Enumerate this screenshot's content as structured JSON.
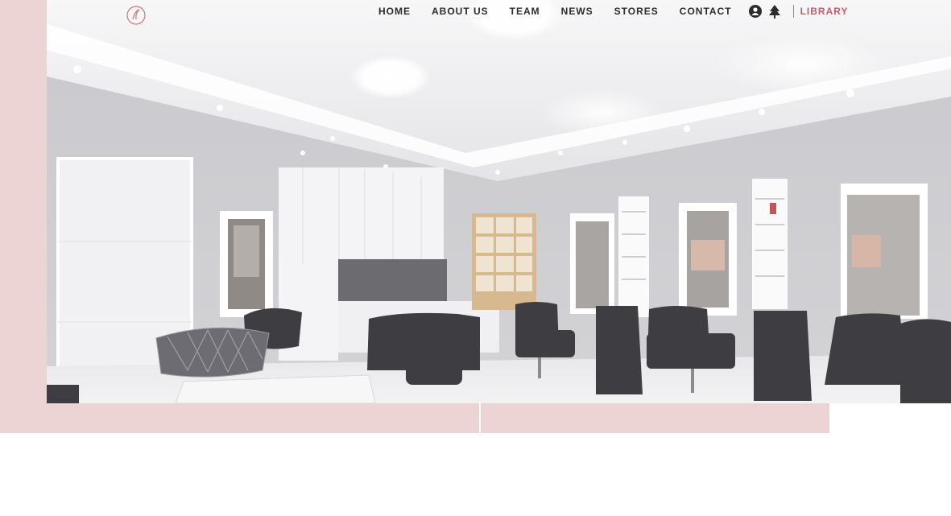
{
  "brand": {
    "name": "",
    "tagline": "",
    "accent_color": "#c47a7a",
    "panel_color": "#ecd4d4"
  },
  "nav": {
    "items": [
      {
        "label": "HOME"
      },
      {
        "label": "ABOUT US"
      },
      {
        "label": "TEAM"
      },
      {
        "label": "NEWS"
      },
      {
        "label": "STORES"
      },
      {
        "label": "CONTACT"
      }
    ],
    "icons": [
      "person-icon",
      "tree-icon"
    ],
    "cta_label": "LIBRARY"
  },
  "hero": {
    "image": "salon-interior-photo"
  }
}
